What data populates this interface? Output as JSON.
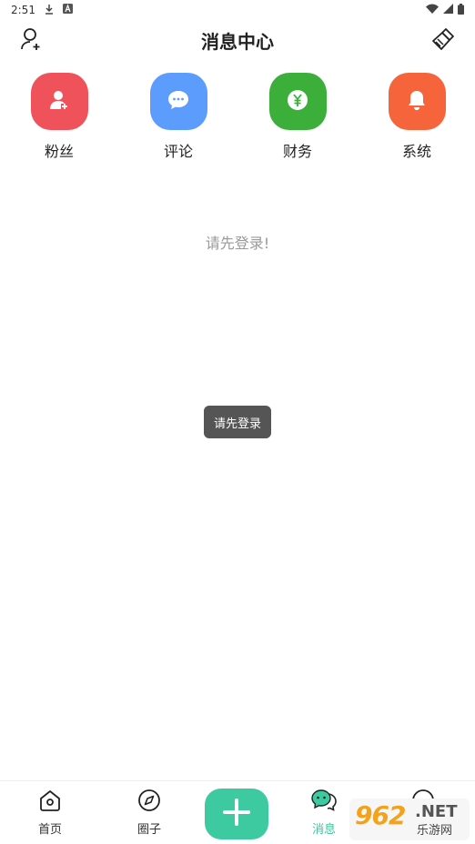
{
  "status_bar": {
    "time": "2:51"
  },
  "header": {
    "title": "消息中心"
  },
  "categories": [
    {
      "label": "粉丝",
      "color": "#f0525c",
      "icon": "user-icon"
    },
    {
      "label": "评论",
      "color": "#5b9cfc",
      "icon": "comment-icon"
    },
    {
      "label": "财务",
      "color": "#3cae3a",
      "icon": "yen-icon"
    },
    {
      "label": "系统",
      "color": "#f5643a",
      "icon": "bell-icon"
    }
  ],
  "main": {
    "empty_message": "请先登录!"
  },
  "toast": {
    "text": "请先登录"
  },
  "bottom_nav": {
    "items": [
      {
        "label": "首页",
        "icon": "home-icon"
      },
      {
        "label": "圈子",
        "icon": "compass-icon"
      },
      {
        "label": "消息",
        "icon": "message-icon",
        "active": true
      }
    ],
    "accent": "#3dcaa0"
  },
  "watermark": {
    "logo": "962",
    "net": ".NET",
    "sub": "乐游网"
  }
}
